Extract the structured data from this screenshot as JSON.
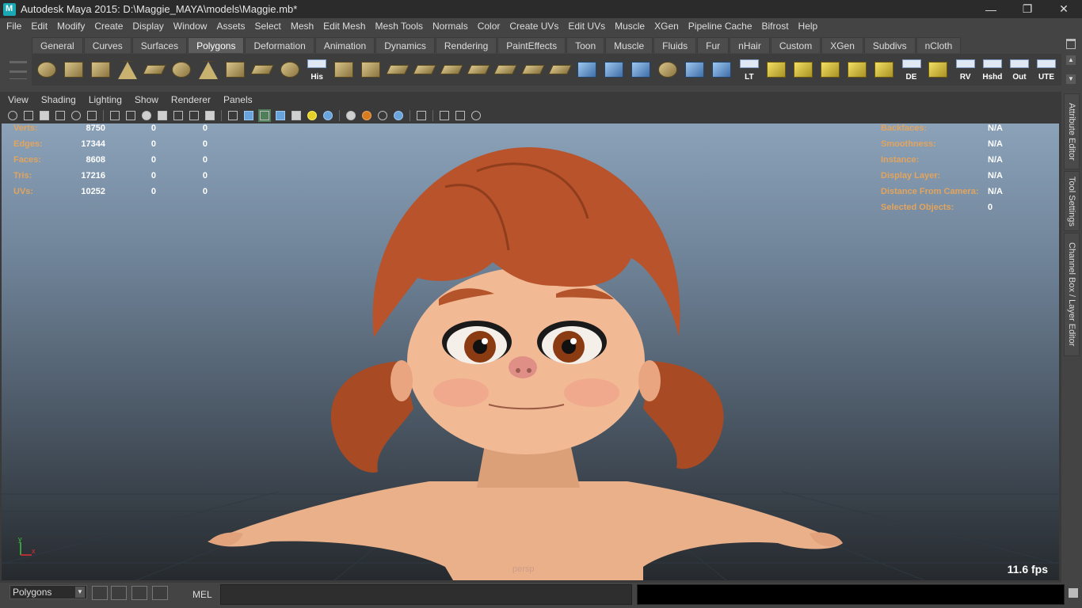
{
  "window": {
    "title": "Autodesk Maya 2015: D:\\Maggie_MAYA\\models\\Maggie.mb*",
    "controls": [
      "minimize",
      "restore",
      "close"
    ]
  },
  "menubar": [
    "File",
    "Edit",
    "Modify",
    "Create",
    "Display",
    "Window",
    "Assets",
    "Select",
    "Mesh",
    "Edit Mesh",
    "Mesh Tools",
    "Normals",
    "Color",
    "Create UVs",
    "Edit UVs",
    "Muscle",
    "XGen",
    "Pipeline Cache",
    "Bifrost",
    "Help"
  ],
  "shelf": {
    "tabs": [
      "General",
      "Curves",
      "Surfaces",
      "Polygons",
      "Deformation",
      "Animation",
      "Dynamics",
      "Rendering",
      "PaintEffects",
      "Toon",
      "Muscle",
      "Fluids",
      "Fur",
      "nHair",
      "Custom",
      "XGen",
      "Subdivs",
      "nCloth"
    ],
    "active_tab": "Polygons",
    "icons": [
      {
        "name": "poly-sphere-icon",
        "label": ""
      },
      {
        "name": "poly-cube-icon",
        "label": ""
      },
      {
        "name": "poly-cylinder-icon",
        "label": ""
      },
      {
        "name": "poly-cone-icon",
        "label": ""
      },
      {
        "name": "poly-plane-icon",
        "label": ""
      },
      {
        "name": "poly-torus-icon",
        "label": ""
      },
      {
        "name": "poly-pyramid-icon",
        "label": ""
      },
      {
        "name": "poly-pipe-icon",
        "label": ""
      },
      {
        "name": "poly-helix-icon",
        "label": ""
      },
      {
        "name": "poly-soccer-ball-icon",
        "label": ""
      },
      {
        "name": "history-icon",
        "label": "His"
      },
      {
        "name": "combine-icon",
        "label": ""
      },
      {
        "name": "separate-icon",
        "label": ""
      },
      {
        "name": "extract-icon",
        "label": ""
      },
      {
        "name": "smooth-icon",
        "label": ""
      },
      {
        "name": "bridge-icon",
        "label": ""
      },
      {
        "name": "append-polygon-icon",
        "label": ""
      },
      {
        "name": "split-polygon-icon",
        "label": ""
      },
      {
        "name": "insert-edge-loop-icon",
        "label": ""
      },
      {
        "name": "extrude-icon",
        "label": ""
      },
      {
        "name": "sculpt-tool-icon",
        "label": ""
      },
      {
        "name": "paint-select-icon",
        "label": ""
      },
      {
        "name": "lattice-icon",
        "label": ""
      },
      {
        "name": "soft-select-icon",
        "label": ""
      },
      {
        "name": "universal-manipulator-icon",
        "label": ""
      },
      {
        "name": "transfer-attributes-icon",
        "label": ""
      },
      {
        "name": "lt-icon",
        "label": "LT"
      },
      {
        "name": "uv-planar-icon",
        "label": ""
      },
      {
        "name": "uv-cylindrical-icon",
        "label": ""
      },
      {
        "name": "uv-spherical-icon",
        "label": ""
      },
      {
        "name": "uv-automatic-icon",
        "label": ""
      },
      {
        "name": "uv-layout-icon",
        "label": ""
      },
      {
        "name": "de-icon",
        "label": "DE"
      },
      {
        "name": "uv-unfold-icon",
        "label": ""
      },
      {
        "name": "rv-icon",
        "label": "RV"
      },
      {
        "name": "hshd-icon",
        "label": "Hshd"
      },
      {
        "name": "out-icon",
        "label": "Out"
      },
      {
        "name": "ute-icon",
        "label": "UTE"
      }
    ]
  },
  "panel": {
    "menu": [
      "View",
      "Shading",
      "Lighting",
      "Show",
      "Renderer",
      "Panels"
    ]
  },
  "hud_left": [
    {
      "label": "Verts:",
      "v1": "8750",
      "v2": "0",
      "v3": "0"
    },
    {
      "label": "Edges:",
      "v1": "17344",
      "v2": "0",
      "v3": "0"
    },
    {
      "label": "Faces:",
      "v1": "8608",
      "v2": "0",
      "v3": "0"
    },
    {
      "label": "Tris:",
      "v1": "17216",
      "v2": "0",
      "v3": "0"
    },
    {
      "label": "UVs:",
      "v1": "10252",
      "v2": "0",
      "v3": "0"
    }
  ],
  "hud_right": [
    {
      "label": "Backfaces:",
      "value": "N/A"
    },
    {
      "label": "Smoothness:",
      "value": "N/A"
    },
    {
      "label": "Instance:",
      "value": "N/A"
    },
    {
      "label": "Display Layer:",
      "value": "N/A"
    },
    {
      "label": "Distance From Camera:",
      "value": "N/A"
    },
    {
      "label": "Selected Objects:",
      "value": "0"
    }
  ],
  "viewport": {
    "camera": "persp",
    "fps": "11.6 fps",
    "axis_y": "y",
    "axis_x": "x"
  },
  "side_tabs": [
    "Attribute Editor",
    "Tool Settings",
    "Channel Box / Layer Editor"
  ],
  "cmdbar": {
    "mode": "Polygons",
    "mel_label": "MEL"
  },
  "colors": {
    "hud_label": "#e2a45e",
    "hair": "#b8532b",
    "skin": "#f0b893",
    "iris": "#8a3b12"
  }
}
